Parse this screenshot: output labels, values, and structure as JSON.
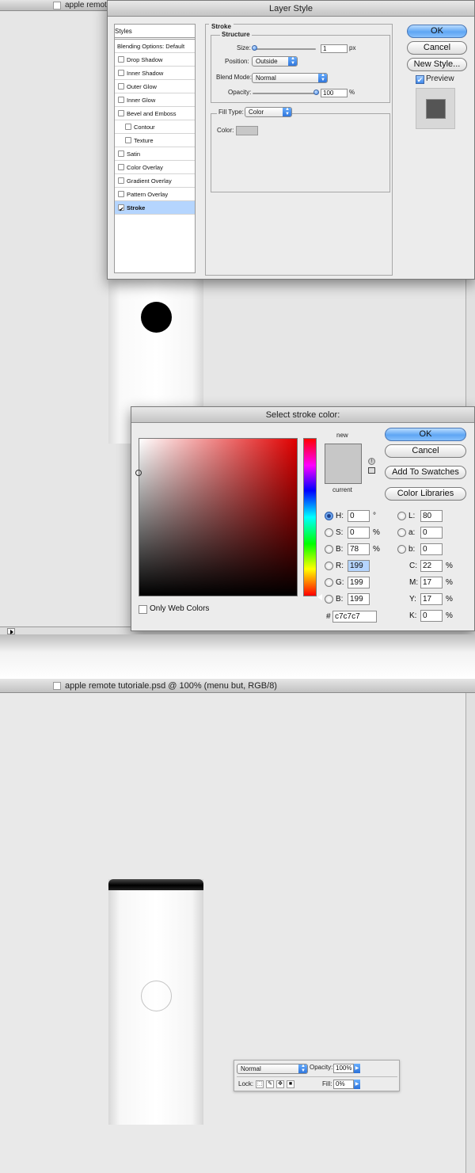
{
  "top_doc": {
    "title": "apple remote"
  },
  "layer_style": {
    "title": "Layer Style",
    "styles_header": "Styles",
    "blending_options": "Blending Options: Default",
    "effects": [
      {
        "label": "Drop Shadow",
        "checked": false,
        "indent": false
      },
      {
        "label": "Inner Shadow",
        "checked": false,
        "indent": false
      },
      {
        "label": "Outer Glow",
        "checked": false,
        "indent": false
      },
      {
        "label": "Inner Glow",
        "checked": false,
        "indent": false
      },
      {
        "label": "Bevel and Emboss",
        "checked": false,
        "indent": false
      },
      {
        "label": "Contour",
        "checked": false,
        "indent": true
      },
      {
        "label": "Texture",
        "checked": false,
        "indent": true
      },
      {
        "label": "Satin",
        "checked": false,
        "indent": false
      },
      {
        "label": "Color Overlay",
        "checked": false,
        "indent": false
      },
      {
        "label": "Gradient Overlay",
        "checked": false,
        "indent": false
      },
      {
        "label": "Pattern Overlay",
        "checked": false,
        "indent": false
      },
      {
        "label": "Stroke",
        "checked": true,
        "indent": false
      }
    ],
    "stroke": {
      "section": "Stroke",
      "structure": "Structure",
      "size_label": "Size:",
      "size_value": "1",
      "size_unit": "px",
      "position_label": "Position:",
      "position_value": "Outside",
      "blend_label": "Blend Mode:",
      "blend_value": "Normal",
      "opacity_label": "Opacity:",
      "opacity_value": "100",
      "opacity_unit": "%",
      "fill_type_label": "Fill Type:",
      "fill_type_value": "Color",
      "color_label": "Color:",
      "color_swatch": "#c7c7c7"
    },
    "buttons": {
      "ok": "OK",
      "cancel": "Cancel",
      "new_style": "New Style..."
    },
    "preview_label": "Preview",
    "preview_checked": true
  },
  "color_picker": {
    "title": "Select stroke color:",
    "new_label": "new",
    "current_label": "current",
    "only_web_colors": "Only Web Colors",
    "buttons": {
      "ok": "OK",
      "cancel": "Cancel",
      "add_swatches": "Add To Swatches",
      "color_libraries": "Color Libraries"
    },
    "hsb": [
      {
        "label": "H:",
        "value": "0",
        "unit": "°",
        "selected": true
      },
      {
        "label": "S:",
        "value": "0",
        "unit": "%",
        "selected": false
      },
      {
        "label": "B:",
        "value": "78",
        "unit": "%",
        "selected": false
      }
    ],
    "rgb": [
      {
        "label": "R:",
        "value": "199"
      },
      {
        "label": "G:",
        "value": "199"
      },
      {
        "label": "B:",
        "value": "199"
      }
    ],
    "lab": [
      {
        "label": "L:",
        "value": "80"
      },
      {
        "label": "a:",
        "value": "0"
      },
      {
        "label": "b:",
        "value": "0"
      }
    ],
    "cmyk": [
      {
        "label": "C:",
        "value": "22",
        "unit": "%"
      },
      {
        "label": "M:",
        "value": "17",
        "unit": "%"
      },
      {
        "label": "Y:",
        "value": "17",
        "unit": "%"
      },
      {
        "label": "K:",
        "value": "0",
        "unit": "%"
      }
    ],
    "hex_label": "#",
    "hex_value": "c7c7c7",
    "new_color": "#c7c7c7",
    "current_color": "#c7c7c7"
  },
  "bottom_doc": {
    "title": "apple remote tutoriale.psd @ 100% (menu but, RGB/8)"
  },
  "layers_panel": {
    "blend_mode": "Normal",
    "opacity_label": "Opacity:",
    "opacity_value": "100%",
    "lock_label": "Lock:",
    "fill_label": "Fill:",
    "fill_value": "0%"
  }
}
